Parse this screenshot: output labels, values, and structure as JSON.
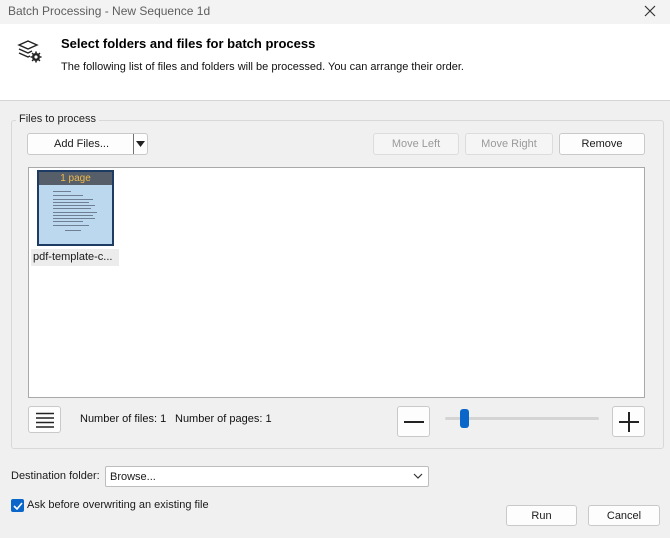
{
  "window": {
    "title": "Batch Processing - New Sequence 1d",
    "close_icon": "close-icon"
  },
  "header": {
    "title": "Select folders and files for batch process",
    "description": "The following list of files and folders will be processed. You can arrange their order.",
    "icon": "batch-settings-icon"
  },
  "files_group": {
    "label": "Files to process",
    "add_files_label": "Add Files...",
    "move_left_label": "Move Left",
    "move_right_label": "Move Right",
    "remove_label": "Remove"
  },
  "file_list": [
    {
      "name": "pdf-template-c...",
      "badge": "1 page"
    }
  ],
  "status": {
    "files_text": "Number of files: 1",
    "pages_text": "Number of pages: 1"
  },
  "zoom": {
    "minus_icon": "zoom-out-icon",
    "plus_icon": "zoom-in-icon",
    "level_fraction": 0.12
  },
  "destination": {
    "label": "Destination folder:",
    "value": "Browse..."
  },
  "overwrite": {
    "label": "Ask before overwriting an existing file",
    "checked": true
  },
  "actions": {
    "run_label": "Run",
    "cancel_label": "Cancel"
  },
  "colors": {
    "accent": "#0a67c9",
    "thumb_bg": "#bcd8ee",
    "badge_text": "#f0b94a"
  }
}
